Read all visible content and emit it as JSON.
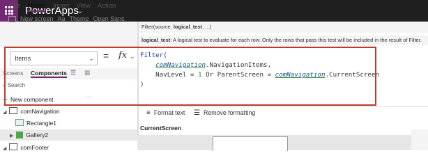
{
  "app": {
    "title": "PowerApps",
    "chevron": "⌄"
  },
  "ribbon": {
    "tabs": [
      "File",
      "Home",
      "Insert",
      "View",
      "Action"
    ],
    "active_tab": "Home",
    "new_screen": "New screen",
    "theme": "Theme",
    "font": "Open Sans"
  },
  "formula_bar": {
    "signature": "Filter(source, logical_test, ...)",
    "signature_prefix": "Filter(source, ",
    "signature_bold": "logical_test",
    "signature_suffix": ", ...)",
    "hint_label": "logical_test",
    "hint_text": ": A logical test to evaluate for each row. Only the rows that pass this test will be included in the result of Filter.",
    "property": "Items",
    "equals": "=",
    "fx": "fx",
    "code": {
      "line1": "Filter(",
      "line2_ctl": "comNavigation",
      "line2_rest": ".NavigationItems,",
      "line3_a": "NavLevel = ",
      "line3_num": "1",
      "line3_b": " Or ParentScreen = ",
      "line3_ctl": "comNavigation",
      "line3_c": ".CurrentScreen",
      "line4": ")"
    },
    "format_text": "Format text",
    "remove_formatting": "Remove formatting",
    "current_result": "CurrentScreen"
  },
  "left_panel": {
    "tab_screens": "Screens",
    "tab_components": "Components",
    "search_placeholder": "Search",
    "new_component": "New component",
    "more": "···",
    "tree": [
      {
        "label": "comNavigation",
        "type": "component"
      },
      {
        "label": "Rectangle1",
        "type": "rectangle"
      },
      {
        "label": "Gallery2",
        "type": "gallery"
      },
      {
        "label": "comFooter",
        "type": "component"
      }
    ]
  },
  "colors": {
    "brand": "#742774",
    "annotation": "#c0392b",
    "topbar": "#1f1f1f"
  }
}
